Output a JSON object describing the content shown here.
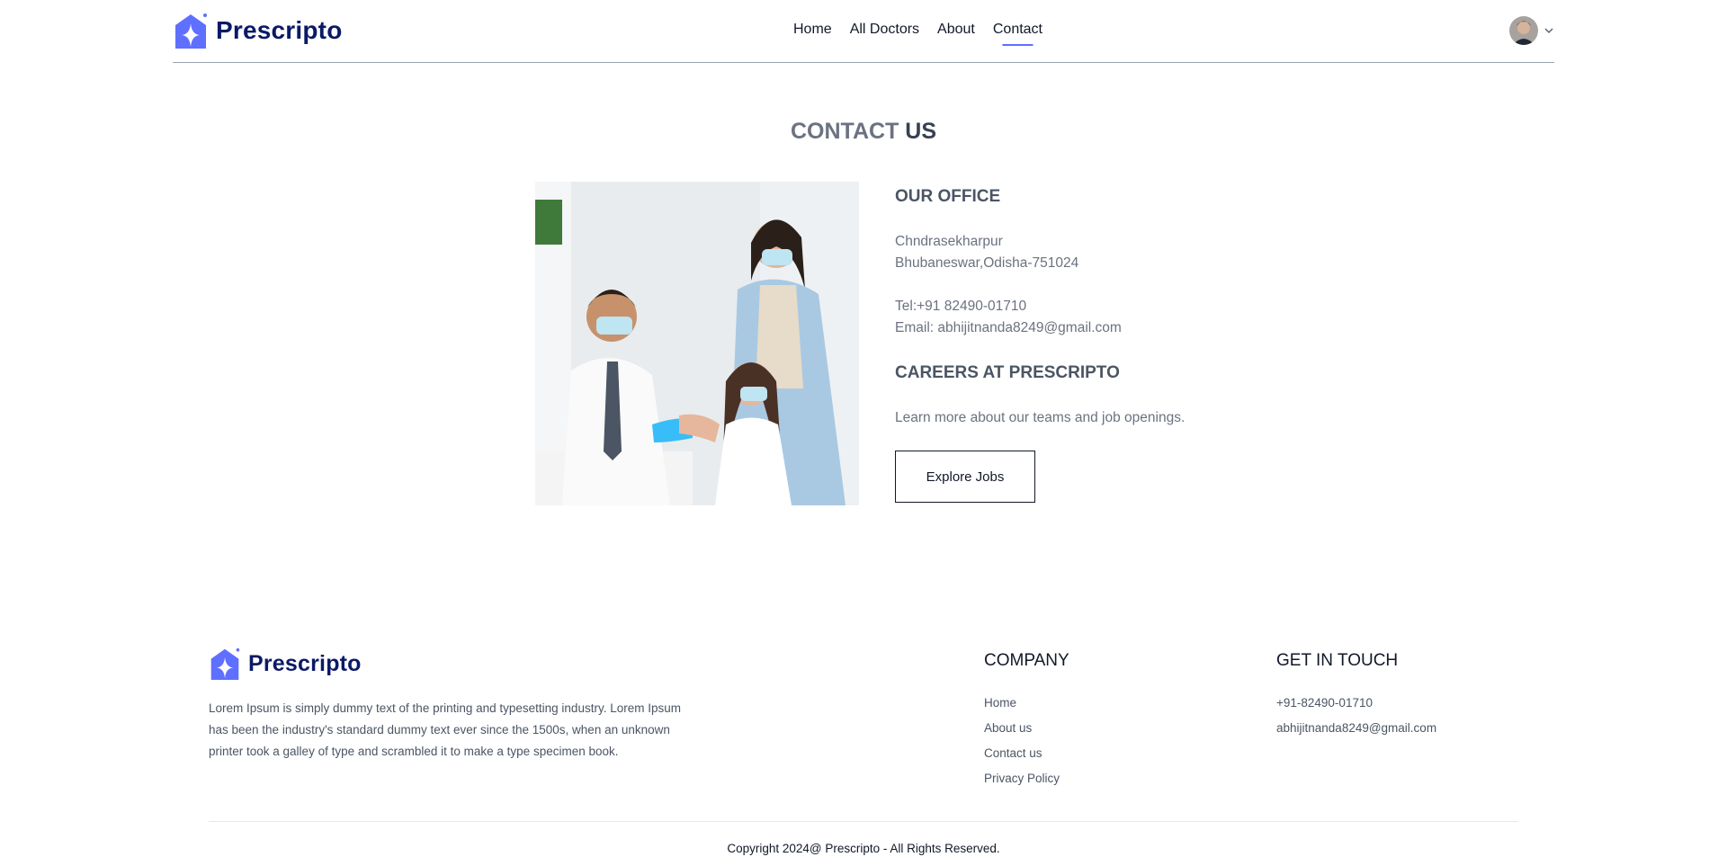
{
  "brand": {
    "name": "Prescripto",
    "accent_color": "#5f6fff",
    "logo_icon": "sparkle-house-icon"
  },
  "nav": {
    "links": [
      {
        "label": "Home"
      },
      {
        "label": "All Doctors"
      },
      {
        "label": "About"
      },
      {
        "label": "Contact",
        "active": true
      }
    ],
    "profile_icon": "user-avatar-icon",
    "dropdown_icon": "chevron-down-icon"
  },
  "contact": {
    "heading_light": "CONTACT",
    "heading_bold": "US",
    "image_alt": "doctor-vaccinating-girl-illustration",
    "office_title": "OUR OFFICE",
    "address_line1": "Chndrasekharpur",
    "address_line2": "Bhubaneswar,Odisha-751024",
    "tel": "Tel:+91 82490-01710",
    "email": "Email: abhijitnanda8249@gmail.com",
    "careers_title": "CAREERS AT PRESCRIPTO",
    "careers_text": "Learn more about our teams and job openings.",
    "button_label": "Explore Jobs"
  },
  "footer": {
    "description": "Lorem Ipsum is simply dummy text of the printing and typesetting industry. Lorem Ipsum has been the industry's standard dummy text ever since the 1500s, when an unknown printer took a galley of type and scrambled it to make a type specimen book.",
    "company_title": "COMPANY",
    "company_links": [
      "Home",
      "About us",
      "Contact us",
      "Privacy Policy"
    ],
    "touch_title": "GET IN TOUCH",
    "phone": "+91-82490-01710",
    "email": "abhijitnanda8249@gmail.com",
    "copyright": "Copyright 2024@ Prescripto - All Rights Reserved."
  }
}
